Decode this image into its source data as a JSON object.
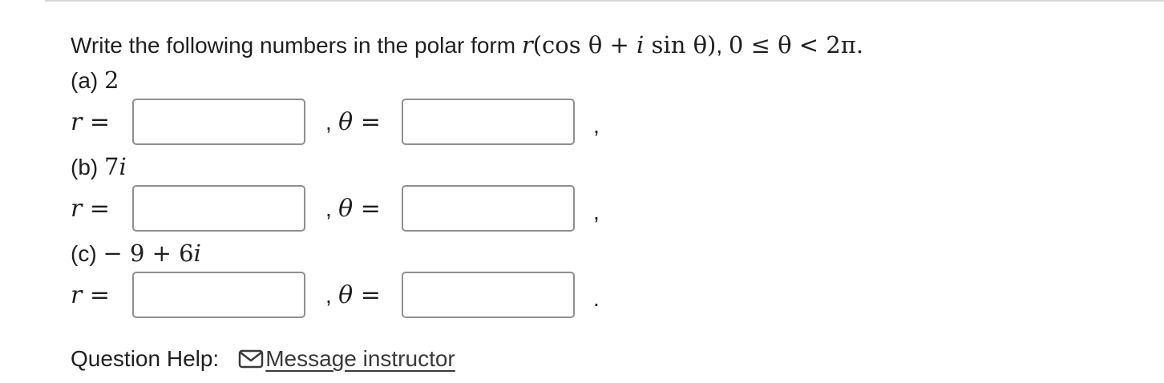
{
  "question": {
    "prefix": "Write the following numbers in the polar form ",
    "form_r": "r",
    "form_body": "(cos θ + ",
    "form_i": "i",
    "form_tail": " sin θ)",
    "range_sep": ", ",
    "range": "0 ≤ θ < 2π."
  },
  "parts": [
    {
      "label": "(a) ",
      "expr_num": "2",
      "expr_i": "",
      "r_label": "r =",
      "theta_sep": ",",
      "theta_label": "θ =",
      "r_value": "",
      "theta_value": "",
      "end_punct": ","
    },
    {
      "label": "(b) ",
      "expr_num": "7",
      "expr_i": "i",
      "r_label": "r =",
      "theta_sep": ",",
      "theta_label": "θ =",
      "r_value": "",
      "theta_value": "",
      "end_punct": ","
    },
    {
      "label": "(c) ",
      "expr_num": "− 9 + 6",
      "expr_i": "i",
      "r_label": "r =",
      "theta_sep": ",",
      "theta_label": "θ =",
      "r_value": "",
      "theta_value": "",
      "end_punct": "."
    }
  ],
  "help": {
    "label": "Question Help:",
    "link_label": "Message instructor",
    "icon": "mail-icon"
  }
}
